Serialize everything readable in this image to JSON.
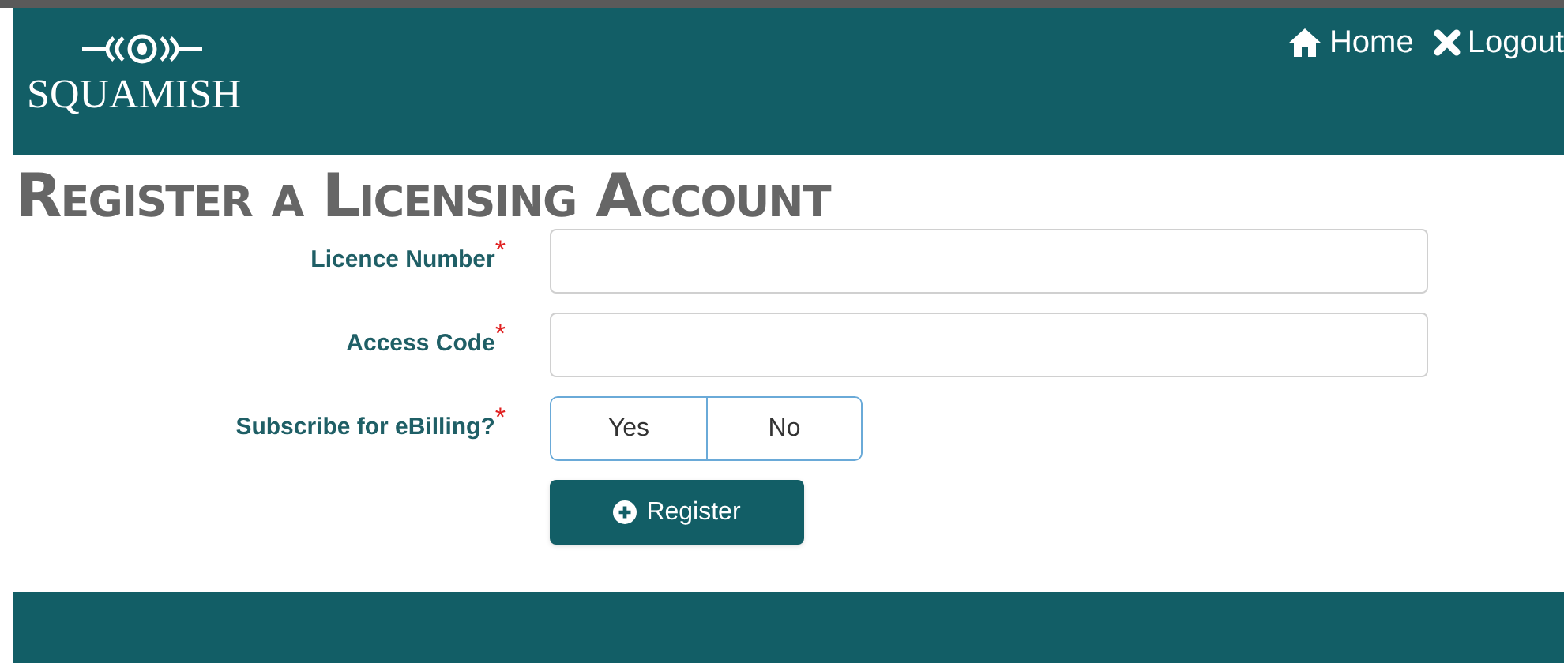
{
  "header": {
    "logo_text": "SQUAMISH",
    "nav": [
      {
        "kind": "home",
        "label": "Home"
      },
      {
        "kind": "logout",
        "label": "Logout"
      }
    ]
  },
  "title": "Register a Licensing Account",
  "form": {
    "fields": [
      {
        "kind": "text",
        "label": "Licence Number",
        "required_mark": "*"
      },
      {
        "kind": "text",
        "label": "Access Code",
        "required_mark": "*"
      },
      {
        "kind": "toggle",
        "label": "Subscribe for eBilling?",
        "required_mark": "*",
        "options": [
          {
            "label": "Yes",
            "selected": false
          },
          {
            "label": "No",
            "selected": false
          }
        ]
      }
    ],
    "submit": "Register"
  }
}
